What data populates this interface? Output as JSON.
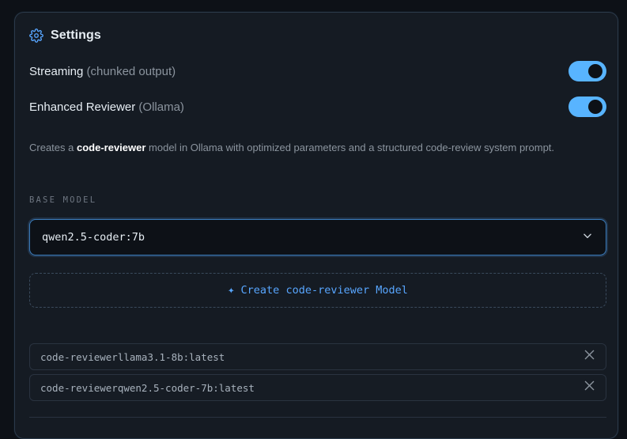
{
  "settings": {
    "title": "Settings",
    "icon": "gear-icon"
  },
  "streaming": {
    "label": "Streaming",
    "hint": "(chunked output)",
    "enabled": true
  },
  "enhanced_reviewer": {
    "label": "Enhanced Reviewer",
    "hint": "(Ollama)",
    "enabled": true
  },
  "description": {
    "prefix": "Creates a ",
    "model_name": "code-reviewer",
    "suffix": " model in Ollama with optimized parameters and a structured code-review system prompt."
  },
  "base_model": {
    "label": "BASE MODEL",
    "selected": "qwen2.5-coder:7b"
  },
  "create_button": {
    "icon": "sparkle-icon",
    "label": "Create code-reviewer Model"
  },
  "models": [
    {
      "name": "code-reviewerllama3.1-8b:latest"
    },
    {
      "name": "code-reviewerqwen2.5-coder-7b:latest"
    }
  ],
  "colors": {
    "accent": "#58a6ff",
    "toggle_on": "#58b4ff",
    "panel_bg": "#151b23",
    "page_bg": "#0d1117"
  }
}
